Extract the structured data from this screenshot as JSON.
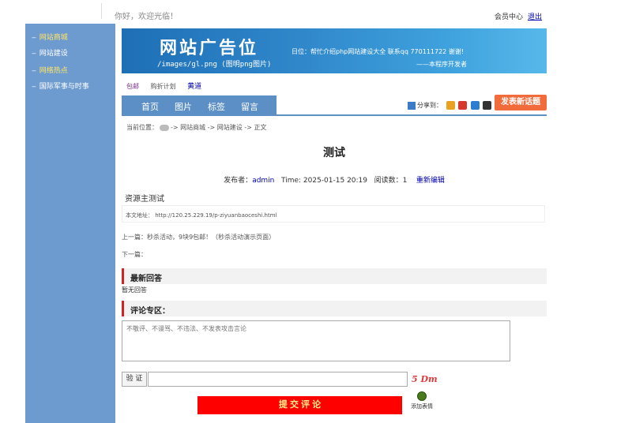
{
  "topbar": {
    "welcome": "你好，欢迎光临！",
    "member_center": "会员中心",
    "logout": "退出"
  },
  "sidebar": {
    "items": [
      {
        "label": "网站商城",
        "color": "yellow"
      },
      {
        "label": "网站建设",
        "color": "white"
      },
      {
        "label": "网络热点",
        "color": "yellow"
      },
      {
        "label": "国际军事与时事",
        "color": "white"
      }
    ]
  },
  "banner": {
    "title": "网站广告位",
    "path": "/images/gl.png  (图明png图片)",
    "note": "日位：帮忙介绍php网站建设大全  联系qq  770111722 谢谢!",
    "sign": "——本程序开发者"
  },
  "sublinks": {
    "a": "包邮",
    "b": "购折计划",
    "c": "黄道"
  },
  "nav": {
    "tabs": [
      "首页",
      "图片",
      "标签",
      "留言"
    ],
    "share_label": "分享到：",
    "post_button": "发表新话题"
  },
  "breadcrumb": {
    "prefix": "当前位置：",
    "path": "-> 网站商城 -> 网站建设 -> 正文"
  },
  "article": {
    "title": "测试",
    "author_label": "发布者：",
    "author": "admin",
    "time": "Time: 2025-01-15 20:19",
    "reads_label": "阅读数：",
    "reads": "1",
    "edit_link": "重新编辑",
    "resource": "资源主测试",
    "url_line": "本文地址：  http://120.25.229.19/p-ziyuanbaoceshi.html",
    "prev": "上一篇：秒杀活动，9块9包邮！（秒杀活动演示页面）",
    "next": "下一篇："
  },
  "replies": {
    "heading": "最新回答",
    "empty": "暂无回答"
  },
  "comments": {
    "heading": "评论专区：",
    "placeholder": "不敬评、不谩骂、不违法、不发表攻击言论",
    "verify_label": "验 证",
    "captcha": "5 Dm",
    "submit": "提 交 评 论",
    "emoji_label": "添加表情"
  }
}
